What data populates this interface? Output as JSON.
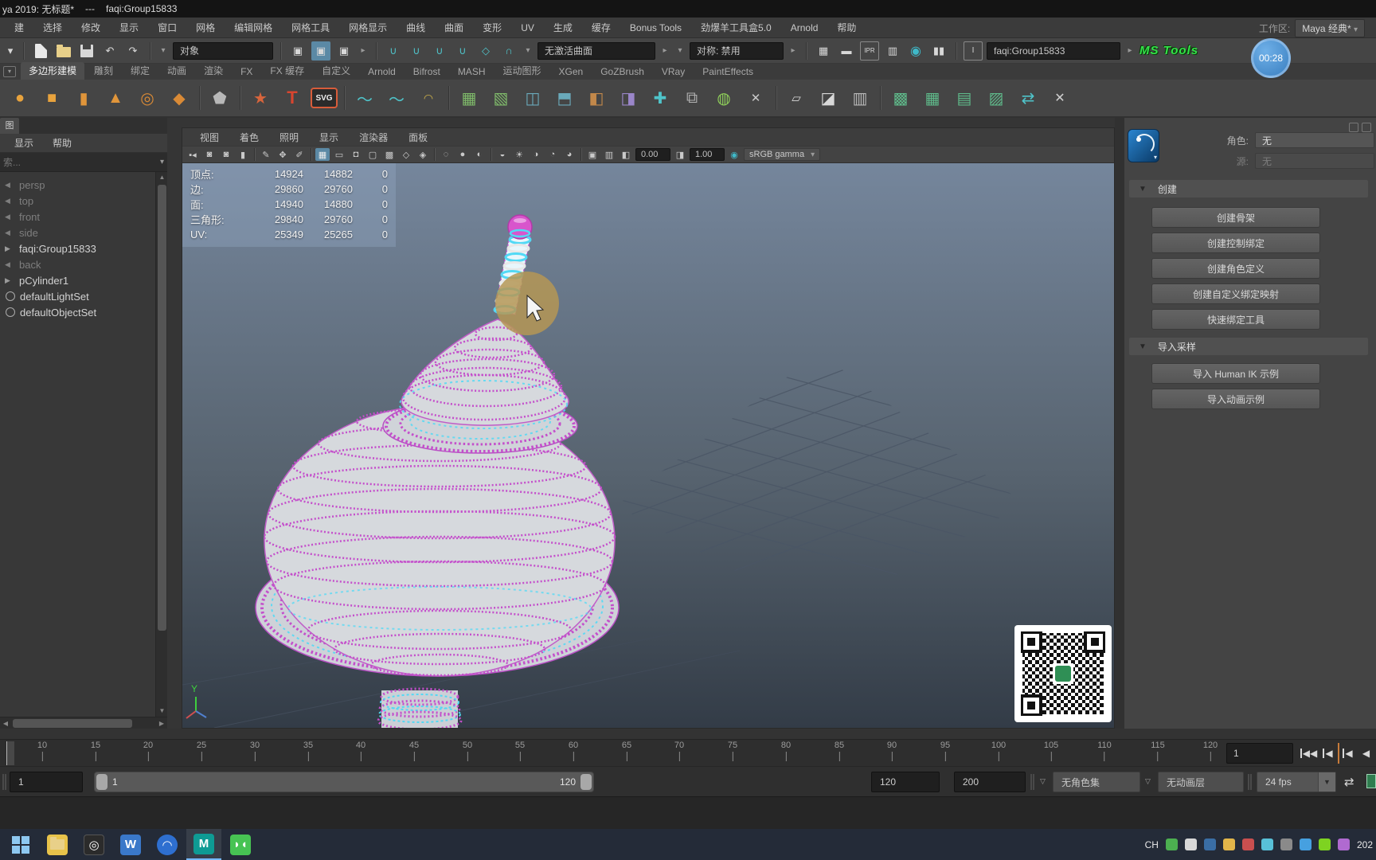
{
  "colors": {
    "accent_blue": "#5b89a5",
    "wire_magenta": "#c44fcb",
    "wire_cyan": "#52d9f5",
    "ms_tools_green": "#35e24a",
    "viewport_top": "#75869c",
    "viewport_bottom": "#343d49"
  },
  "title_bar": {
    "title": "ya 2019: 无标题*",
    "dashes": "---",
    "scene_name": "faqi:Group15833"
  },
  "menu_bar": {
    "items": [
      "建",
      "选择",
      "修改",
      "显示",
      "窗口",
      "网格",
      "编辑网格",
      "网格工具",
      "网格显示",
      "曲线",
      "曲面",
      "变形",
      "UV",
      "生成",
      "缓存",
      "Bonus Tools",
      "劲爆羊工具盒5.0",
      "Arnold",
      "帮助"
    ],
    "workspace_label": "工作区:",
    "workspace_value": "Maya 经典*"
  },
  "toolbar": {
    "selection_mask": "对象",
    "no_active_surface": "无激活曲面",
    "symmetry": "对称: 禁用",
    "ipr_label": "IPR",
    "quick_field": "faqi:Group15833",
    "ms_tools": "MS Tools"
  },
  "recording_timer": "00:28",
  "shelf": {
    "tabs": [
      "多边形建模",
      "雕刻",
      "绑定",
      "动画",
      "渲染",
      "FX",
      "FX 缓存",
      "自定义",
      "Arnold",
      "Bifrost",
      "MASH",
      "运动图形",
      "XGen",
      "GoZBrush",
      "VRay",
      "PaintEffects"
    ]
  },
  "outliner": {
    "tab": "图",
    "menus": [
      "显示",
      "帮助"
    ],
    "search_placeholder": "索...",
    "items": [
      {
        "label": "persp"
      },
      {
        "label": "top"
      },
      {
        "label": "front"
      },
      {
        "label": "side"
      },
      {
        "label": "faqi:Group15833"
      },
      {
        "label": "back"
      },
      {
        "label": "pCylinder1"
      },
      {
        "label": "defaultLightSet"
      },
      {
        "label": "defaultObjectSet"
      }
    ]
  },
  "viewport": {
    "menus": [
      "视图",
      "着色",
      "照明",
      "显示",
      "渲染器",
      "面板"
    ],
    "exposure": "0.00",
    "gamma": "1.00",
    "colorspace": "sRGB gamma",
    "axis_label": "Y",
    "hud": {
      "rows": [
        {
          "label": "顶点:",
          "a": "14924",
          "b": "14882",
          "c": "0"
        },
        {
          "label": "边:",
          "a": "29860",
          "b": "29760",
          "c": "0"
        },
        {
          "label": "面:",
          "a": "14940",
          "b": "14880",
          "c": "0"
        },
        {
          "label": "三角形:",
          "a": "29840",
          "b": "29760",
          "c": "0"
        },
        {
          "label": "UV:",
          "a": "25349",
          "b": "25265",
          "c": "0"
        }
      ]
    }
  },
  "humanik": {
    "character_label": "角色:",
    "character_value": "无",
    "source_label": "源:",
    "source_value": "无",
    "create_section": "创建",
    "import_section": "导入采样",
    "create_buttons": [
      "创建骨架",
      "创建控制绑定",
      "创建角色定义",
      "创建自定义绑定映射",
      "快速绑定工具"
    ],
    "import_buttons": [
      "导入 Human IK 示例",
      "导入动画示例"
    ]
  },
  "timeline": {
    "ticks": [
      "10",
      "15",
      "20",
      "25",
      "30",
      "35",
      "40",
      "45",
      "50",
      "55",
      "60",
      "65",
      "70",
      "75",
      "80",
      "85",
      "90",
      "95",
      "100",
      "105",
      "110",
      "115",
      "120"
    ],
    "current_frame": "1"
  },
  "range_bar": {
    "playback_start": "1",
    "range_start": "1",
    "range_end": "120",
    "playback_end": "120",
    "scene_end": "200",
    "character_set": "无角色集",
    "animation_layer": "无动画层",
    "fps": "24 fps"
  },
  "taskbar": {
    "input_indicator": "CH",
    "clock": "202"
  }
}
